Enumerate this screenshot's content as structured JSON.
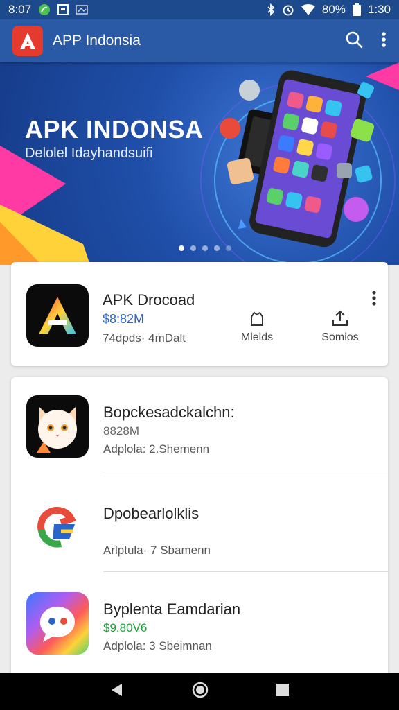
{
  "status_bar": {
    "time": "1:30",
    "left_text": "8:07",
    "battery": "80%"
  },
  "app_bar": {
    "title": "APP Indonsia"
  },
  "banner": {
    "title": "APK INDONSA",
    "subtitle": "Delolel Idayhandsuifi",
    "slide_count": 5,
    "active_slide": 1
  },
  "featured": {
    "name": "APK Drocoad",
    "price": "$8:82M",
    "meta": "74dpds· 4mDalt",
    "action_1_label": "Mleids",
    "action_2_label": "Somios"
  },
  "list": {
    "items": [
      {
        "name": "Bopckesadckalchn:",
        "price": "8828M",
        "meta": "Adplola: 2.Shemenn"
      },
      {
        "name": "Dpobearlolklis",
        "price": "",
        "meta": "Arlptula· 7 Sbamenn"
      },
      {
        "name": "Byplenta Eamdarian",
        "price": "$9.80V6",
        "meta": "Adplola: 3 Sbeimnan"
      }
    ]
  },
  "colors": {
    "app_bar": "#2a5aa6",
    "accent_red": "#e53a2e",
    "price_blue": "#2a66c9",
    "price_green": "#1e9e3a"
  }
}
